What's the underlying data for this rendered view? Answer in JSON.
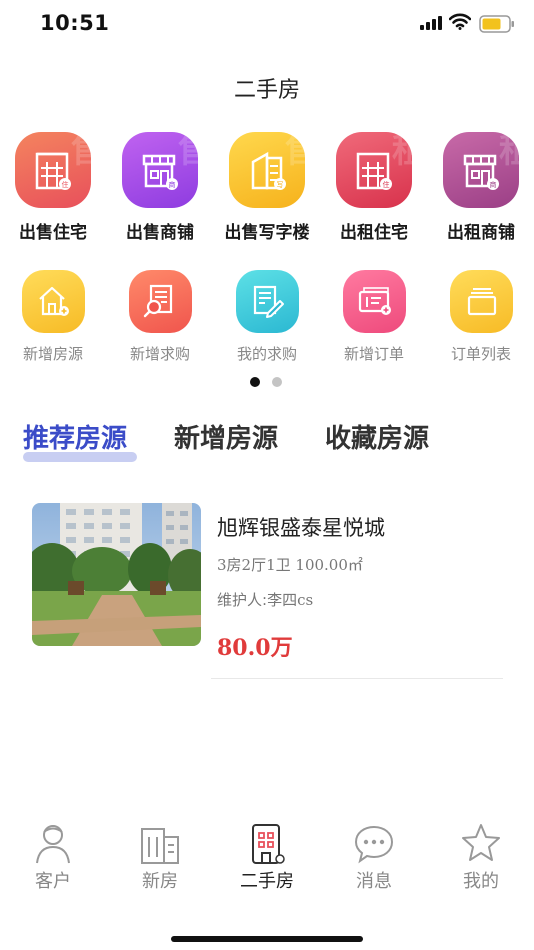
{
  "status_bar": {
    "time": "10:51"
  },
  "header": {
    "title": "二手房"
  },
  "categories": [
    {
      "label": "出售住宅",
      "icon": "building-icon",
      "badge": "住",
      "bg": [
        "#f4845f",
        "#e8505b"
      ],
      "watermark": "售"
    },
    {
      "label": "出售商铺",
      "icon": "shop-icon",
      "badge": "商",
      "bg": [
        "#c063f0",
        "#8e3ce0"
      ],
      "watermark": "售"
    },
    {
      "label": "出售写字楼",
      "icon": "office-icon",
      "badge": "写",
      "bg": [
        "#ffd84d",
        "#f6b21c"
      ],
      "watermark": "售"
    },
    {
      "label": "出租住宅",
      "icon": "building-icon",
      "badge": "住",
      "bg": [
        "#f06a7a",
        "#d8324c"
      ],
      "watermark": "租"
    },
    {
      "label": "出租商铺",
      "icon": "shop-icon",
      "badge": "商",
      "bg": [
        "#c86aa8",
        "#9b3f86"
      ],
      "watermark": "租"
    }
  ],
  "actions": [
    {
      "label": "新增房源",
      "icon": "house-add-icon",
      "bg": [
        "#ffdc5a",
        "#f7bb26"
      ]
    },
    {
      "label": "新增求购",
      "icon": "document-search-icon",
      "bg": [
        "#ff8a6a",
        "#f0554d"
      ]
    },
    {
      "label": "我的求购",
      "icon": "document-edit-icon",
      "bg": [
        "#5de0e6",
        "#2bb8d2"
      ]
    },
    {
      "label": "新增订单",
      "icon": "ticket-add-icon",
      "bg": [
        "#ff7aa0",
        "#ee4a7c"
      ]
    },
    {
      "label": "订单列表",
      "icon": "list-box-icon",
      "bg": [
        "#ffdc5a",
        "#f7bb26"
      ]
    }
  ],
  "pager": {
    "page_count": 2,
    "active_index": 0,
    "active_color": "#111111",
    "inactive_color": "#c4c4c4"
  },
  "tabs": [
    {
      "label": "推荐房源",
      "active": true
    },
    {
      "label": "新增房源",
      "active": false
    },
    {
      "label": "收藏房源",
      "active": false
    }
  ],
  "listings": [
    {
      "title": "旭辉银盛泰星悦城",
      "specs": "3房2厅1卫 100.00㎡",
      "agent_label": "维护人:",
      "agent_name": "李四cs",
      "price": "80.0万"
    }
  ],
  "bottom_nav": [
    {
      "label": "客户",
      "icon": "customer-icon",
      "active": false
    },
    {
      "label": "新房",
      "icon": "new-house-icon",
      "active": false
    },
    {
      "label": "二手房",
      "icon": "second-hand-house-icon",
      "active": true
    },
    {
      "label": "消息",
      "icon": "message-icon",
      "active": false
    },
    {
      "label": "我的",
      "icon": "star-icon",
      "active": false
    }
  ],
  "colors": {
    "accent": "#3b4cc8",
    "price": "#e03b3b",
    "nav_inactive": "#888888"
  }
}
